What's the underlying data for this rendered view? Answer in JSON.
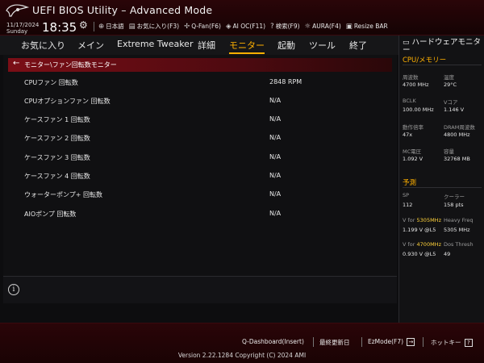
{
  "header": {
    "title": "UEFI BIOS Utility – Advanced Mode",
    "date": "11/17/2024",
    "day": "Sunday",
    "time": "18:35",
    "tools": [
      {
        "icon": "globe-icon",
        "label": "日本語"
      },
      {
        "icon": "favorites-icon",
        "label": "お気に入り(F3)"
      },
      {
        "icon": "fan-icon",
        "label": "Q-Fan(F6)"
      },
      {
        "icon": "ai-oc-icon",
        "label": "AI OC(F11)"
      },
      {
        "icon": "search-icon",
        "label": "検索(F9)"
      },
      {
        "icon": "aura-icon",
        "label": "AURA(F4)"
      },
      {
        "icon": "resize-bar-icon",
        "label": "Resize BAR"
      }
    ]
  },
  "tabs": [
    {
      "label": "お気に入り",
      "active": false
    },
    {
      "label": "メイン",
      "active": false
    },
    {
      "label": "Extreme Tweaker",
      "active": false
    },
    {
      "label": "詳細",
      "active": false
    },
    {
      "label": "モニター",
      "active": true
    },
    {
      "label": "起動",
      "active": false
    },
    {
      "label": "ツール",
      "active": false
    },
    {
      "label": "終了",
      "active": false
    }
  ],
  "breadcrumb": "モニター\\ファン回転数モニター",
  "rows": [
    {
      "label": "CPUファン 回転数",
      "value": "2848 RPM"
    },
    {
      "label": "CPUオプションファン 回転数",
      "value": "N/A"
    },
    {
      "label": "ケースファン 1 回転数",
      "value": "N/A"
    },
    {
      "label": "ケースファン 2 回転数",
      "value": "N/A"
    },
    {
      "label": "ケースファン 3 回転数",
      "value": "N/A"
    },
    {
      "label": "ケースファン 4 回転数",
      "value": "N/A"
    },
    {
      "label": "ウォーターポンプ+ 回転数",
      "value": "N/A"
    },
    {
      "label": "AIOポンプ 回転数",
      "value": "N/A"
    }
  ],
  "hw_monitor": {
    "title": "ハードウェアモニター",
    "cpu_section": "CPU/メモリー",
    "cpu_items": [
      {
        "k": "周波数",
        "v": "4700 MHz"
      },
      {
        "k": "温度",
        "v": "29°C"
      },
      {
        "k": "BCLK",
        "v": "100.00 MHz"
      },
      {
        "k": "Vコア",
        "v": "1.146 V"
      },
      {
        "k": "動作倍率",
        "v": "47x"
      },
      {
        "k": "DRAM周波数",
        "v": "4800 MHz"
      },
      {
        "k": "MC電圧",
        "v": "1.092 V"
      },
      {
        "k": "容量",
        "v": "32768 MB"
      }
    ],
    "pred_section": "予測",
    "sp_k": "SP",
    "sp_v": "112",
    "cooler_k": "クーラー",
    "cooler_v": "158 pts",
    "v_for": "V for",
    "freq1": "5305MHz",
    "heavy_k": "Heavy Freq",
    "freq1_v": "1.199 V @L5",
    "heavy_v": "5305 MHz",
    "freq2": "4700MHz",
    "dos_k": "Dos Thresh",
    "freq2_v": "0.930 V @L5",
    "dos_v": "49"
  },
  "footer": {
    "qdash": "Q-Dashboard(Insert)",
    "last_change": "最終更新日",
    "ezmode": "EzMode(F7)",
    "hotkey": "ホットキー",
    "hotkey_badge": "?",
    "version": "Version 2.22.1284 Copyright (C) 2024 AMI"
  },
  "colors": {
    "accent": "#ffb000",
    "highlight": "#ffd23a",
    "brand_red": "#7b0e16"
  }
}
